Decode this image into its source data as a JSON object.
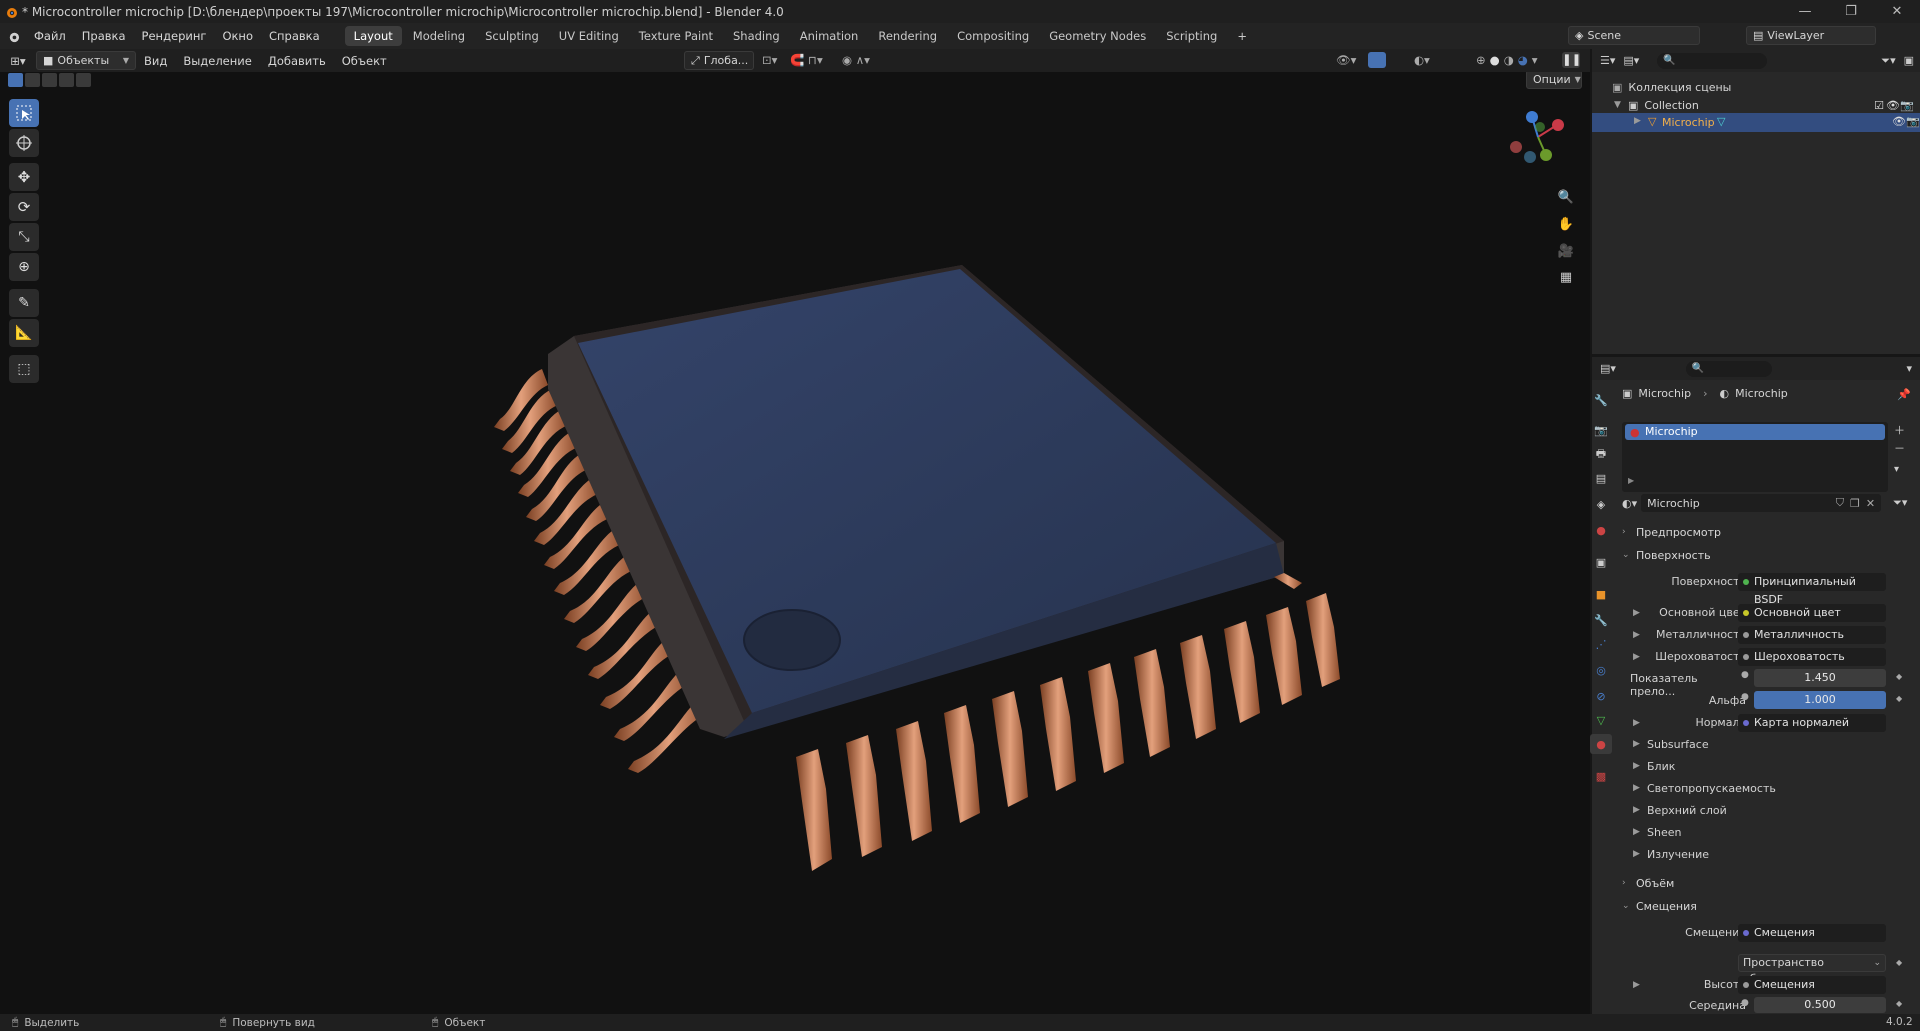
{
  "window": {
    "title": "* Microcontroller microchip [D:\\блендер\\проекты 197\\Microcontroller microchip\\Microcontroller microchip.blend] - Blender 4.0",
    "minimize": "—",
    "maximize": "❐",
    "close": "✕"
  },
  "menu": [
    "Файл",
    "Правка",
    "Рендеринг",
    "Окно",
    "Справка"
  ],
  "workspaces": [
    "Layout",
    "Modeling",
    "Sculpting",
    "UV Editing",
    "Texture Paint",
    "Shading",
    "Animation",
    "Rendering",
    "Compositing",
    "Geometry Nodes",
    "Scripting"
  ],
  "workspace_add": "+",
  "scene": {
    "label": "Scene",
    "view_layer": "ViewLayer"
  },
  "viewport_header": {
    "mode": "Объекты",
    "items": [
      "Вид",
      "Выделение",
      "Добавить",
      "Объект"
    ],
    "orientation": "Глоба...",
    "options": "Опции"
  },
  "outliner": {
    "root": "Коллекция сцены",
    "collection": "Collection",
    "object": "Microchip"
  },
  "properties": {
    "breadcrumb_object": "Microchip",
    "breadcrumb_material": "Microchip",
    "slot_name": "Microchip",
    "material_name": "Microchip",
    "sections": {
      "preview": "Предпросмотр",
      "surface": "Поверхность",
      "volume": "Объём",
      "displacement": "Смещения"
    },
    "surface_rows": [
      {
        "label": "Поверхность",
        "value": "Принципиальный BSDF",
        "dot": "#4fb34f",
        "expand": false
      },
      {
        "label": "Основной цвет",
        "value": "Основной цвет",
        "dot": "#c7c729",
        "expand": true
      },
      {
        "label": "Металличность",
        "value": "Металличность",
        "dot": "#9a9a9a",
        "expand": true
      },
      {
        "label": "Шероховатость",
        "value": "Шероховатость",
        "dot": "#9a9a9a",
        "expand": true
      }
    ],
    "ior": {
      "label": "Показатель прело...",
      "value": "1.450"
    },
    "alpha": {
      "label": "Альфа",
      "value": "1.000"
    },
    "normal": {
      "label": "Нормаль",
      "value": "Карта нормалей"
    },
    "subpanels": [
      "Subsurface",
      "Блик",
      "Светопропускаемость",
      "Верхний слой",
      "Sheen",
      "Излучение"
    ],
    "displacement_rows": {
      "disp_label": "Смещения",
      "disp_value": "Смещения",
      "space_value": "Пространство объекта",
      "height_label": "Высота",
      "height_value": "Смещения",
      "mid_label": "Середина",
      "mid_value": "0.500"
    }
  },
  "status": {
    "select": "Выделить",
    "rotate": "Повернуть вид",
    "object": "Объект",
    "version": "4.0.2"
  },
  "colors": {
    "accent": "#4772b3",
    "chip_body": "#2d3a57",
    "pins": "#b9704a",
    "viewport_bg": "#111111"
  }
}
